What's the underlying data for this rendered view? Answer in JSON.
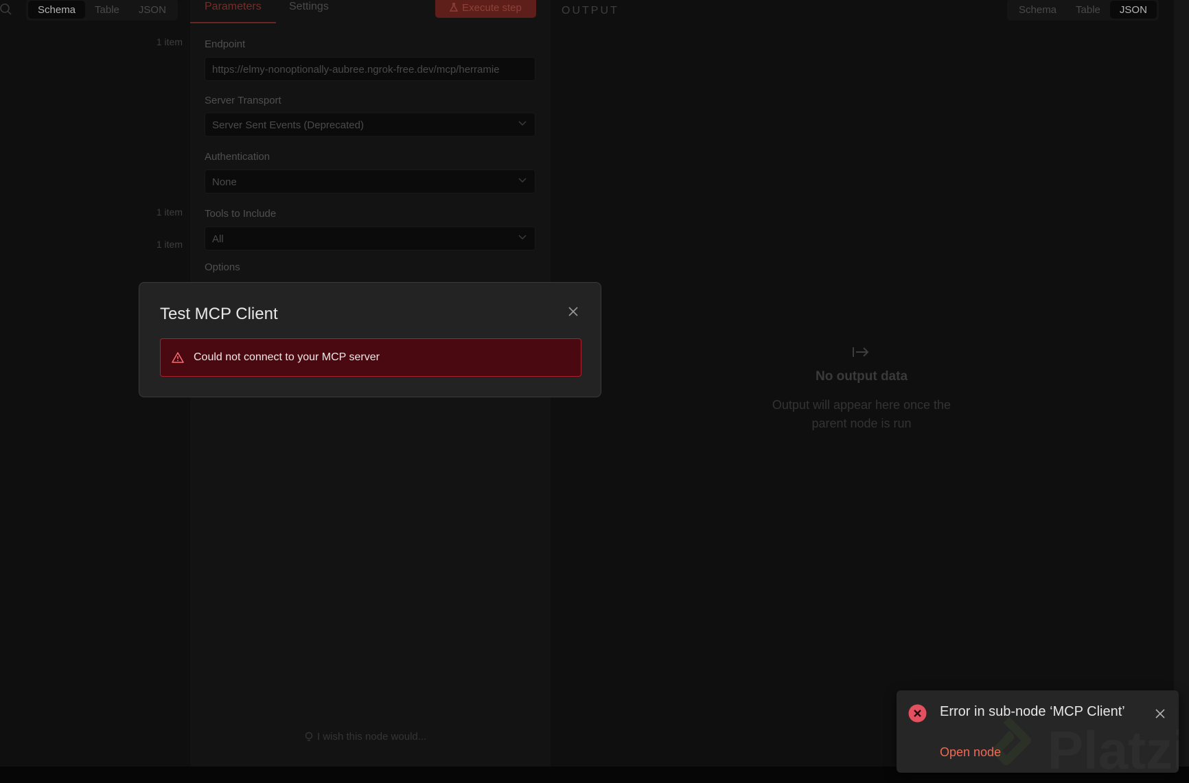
{
  "left_panel": {
    "view_tabs": [
      "Schema",
      "Table",
      "JSON"
    ],
    "active_tab": "Schema",
    "item_counts": [
      "1 item",
      "1 item",
      "1 item"
    ]
  },
  "params_panel": {
    "tabs": [
      "Parameters",
      "Settings"
    ],
    "active_tab": "Parameters",
    "execute_label": "Execute step",
    "fields": {
      "endpoint": {
        "label": "Endpoint",
        "value": "https://elmy-nonoptionally-aubree.ngrok-free.dev/mcp/herramie"
      },
      "transport": {
        "label": "Server Transport",
        "value": "Server Sent Events (Deprecated)"
      },
      "auth": {
        "label": "Authentication",
        "value": "None"
      },
      "tools": {
        "label": "Tools to Include",
        "value": "All"
      }
    },
    "options_label": "Options",
    "wish_text": "I wish this node would..."
  },
  "output_panel": {
    "title": "OUTPUT",
    "view_tabs": [
      "Schema",
      "Table",
      "JSON"
    ],
    "active_tab": "JSON",
    "empty_title": "No output data",
    "empty_subtitle_line1": "Output will appear here once the",
    "empty_subtitle_line2": "parent node is run"
  },
  "modal": {
    "title": "Test MCP Client",
    "error_message": "Could not connect to your MCP server"
  },
  "toast": {
    "title": "Error in sub-node ‘MCP Client’",
    "link": "Open node",
    "watermark": "Platzi"
  },
  "colors": {
    "error_accent": "#a5232e",
    "alert_background": "#4a0910",
    "toast_link": "#ef6a55",
    "toast_error_icon": "#e4505f"
  }
}
